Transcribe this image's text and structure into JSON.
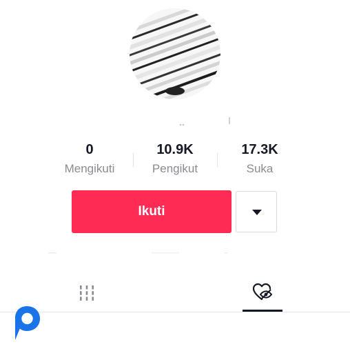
{
  "profile": {
    "avatar_icon": "profile-avatar"
  },
  "stats": {
    "following": {
      "value": "0",
      "label": "Mengikuti"
    },
    "followers": {
      "value": "10.9K",
      "label": "Pengikut"
    },
    "likes": {
      "value": "17.3K",
      "label": "Suka"
    }
  },
  "actions": {
    "follow_label": "Ikuti",
    "dropdown_icon": "caret-down-icon"
  },
  "tabs": [
    {
      "name": "videos",
      "icon": "grid-icon",
      "active": false
    },
    {
      "name": "liked",
      "icon": "liked-hidden-icon",
      "active": true
    }
  ],
  "colors": {
    "accent": "#fe2c55",
    "text_primary": "#161823",
    "text_secondary": "#8a8b91",
    "watermark": "#1a73e8"
  }
}
